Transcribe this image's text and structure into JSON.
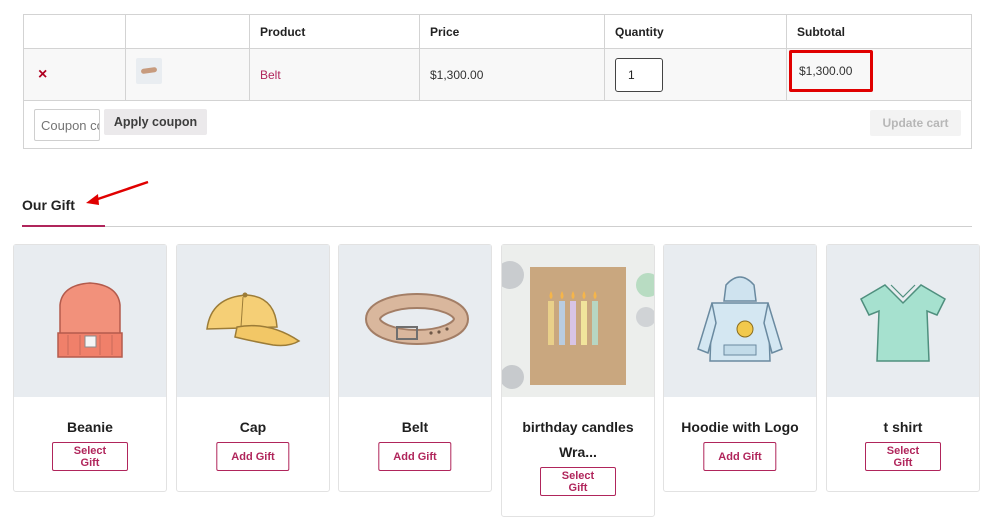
{
  "cart": {
    "headers": [
      "",
      "",
      "Product",
      "Price",
      "Quantity",
      "Subtotal"
    ],
    "item": {
      "remove": "×",
      "product": "Belt",
      "price": "$1,300.00",
      "quantity": "1",
      "subtotal": "$1,300.00"
    },
    "coupon_placeholder": "Coupon code",
    "apply_coupon": "Apply coupon",
    "update_cart": "Update cart"
  },
  "gifts": {
    "title": "Our Gift",
    "items": [
      {
        "name": "Beanie",
        "button": "Select Gift",
        "icon": "beanie-icon"
      },
      {
        "name": "Cap",
        "button": "Add Gift",
        "icon": "cap-icon"
      },
      {
        "name": "Belt",
        "button": "Add Gift",
        "icon": "belt-icon"
      },
      {
        "name": "birthday candles Wra...",
        "button": "Select Gift",
        "icon": "gift-box-icon"
      },
      {
        "name": "Hoodie with Logo",
        "button": "Add Gift",
        "icon": "hoodie-icon"
      },
      {
        "name": "t shirt",
        "button": "Select Gift",
        "icon": "tshirt-icon"
      }
    ]
  },
  "colors": {
    "accent": "#b0255b",
    "highlight": "#e00000",
    "remove": "#b00020"
  }
}
